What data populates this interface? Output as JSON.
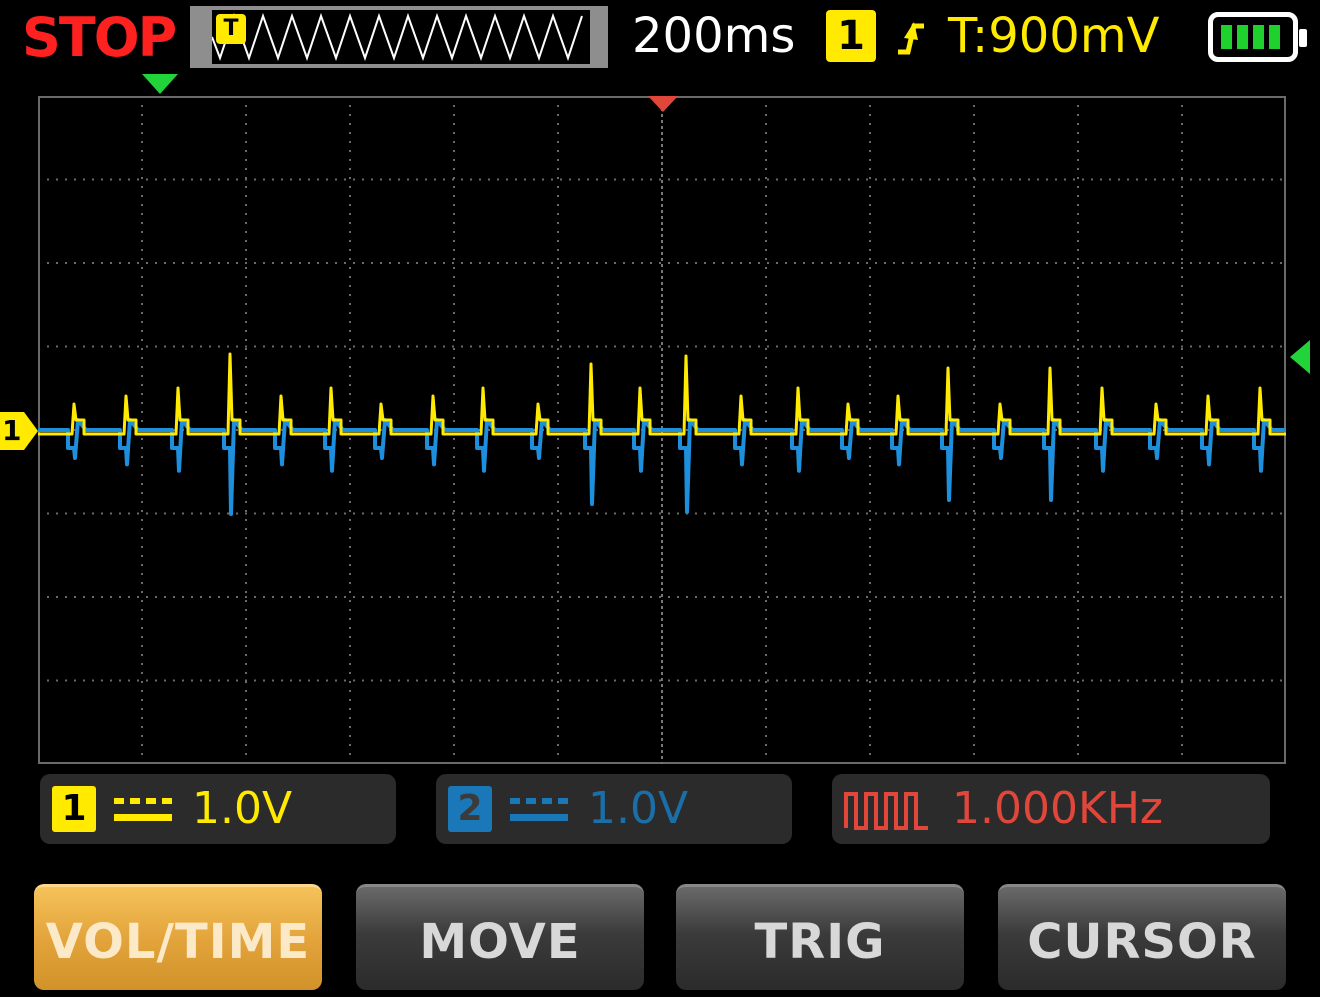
{
  "status": {
    "label": "STOP",
    "color": "#ff2020"
  },
  "overview": {
    "trigger_badge": "T"
  },
  "timebase": "200ms",
  "trigger": {
    "channel": "1",
    "edge_icon": "rising-edge-icon",
    "level": "T:900mV"
  },
  "battery": {
    "icon": "battery-icon",
    "bars": 4
  },
  "markers": {
    "ch1_ground": "1",
    "trigger_position_icon": "triangle-down-red",
    "horizontal_position_icon": "triangle-down-green",
    "trigger_level_icon": "triangle-left-green"
  },
  "channels": [
    {
      "num": "1",
      "coupling_icon": "dc-coupling-icon",
      "scale": "1.0V",
      "color": "#ffea00"
    },
    {
      "num": "2",
      "coupling_icon": "dc-coupling-icon",
      "scale": "1.0V",
      "color": "#1a78b8"
    }
  ],
  "generator": {
    "icon": "square-wave-icon",
    "frequency": "1.000KHz",
    "color": "#e0473a"
  },
  "softkeys": [
    {
      "label": "VOL/TIME",
      "active": true
    },
    {
      "label": "MOVE",
      "active": false
    },
    {
      "label": "TRIG",
      "active": false
    },
    {
      "label": "CURSOR",
      "active": false
    }
  ],
  "colors": {
    "ch1": "#ffea00",
    "ch2": "#1e8fdc",
    "grid": "#777777"
  }
}
